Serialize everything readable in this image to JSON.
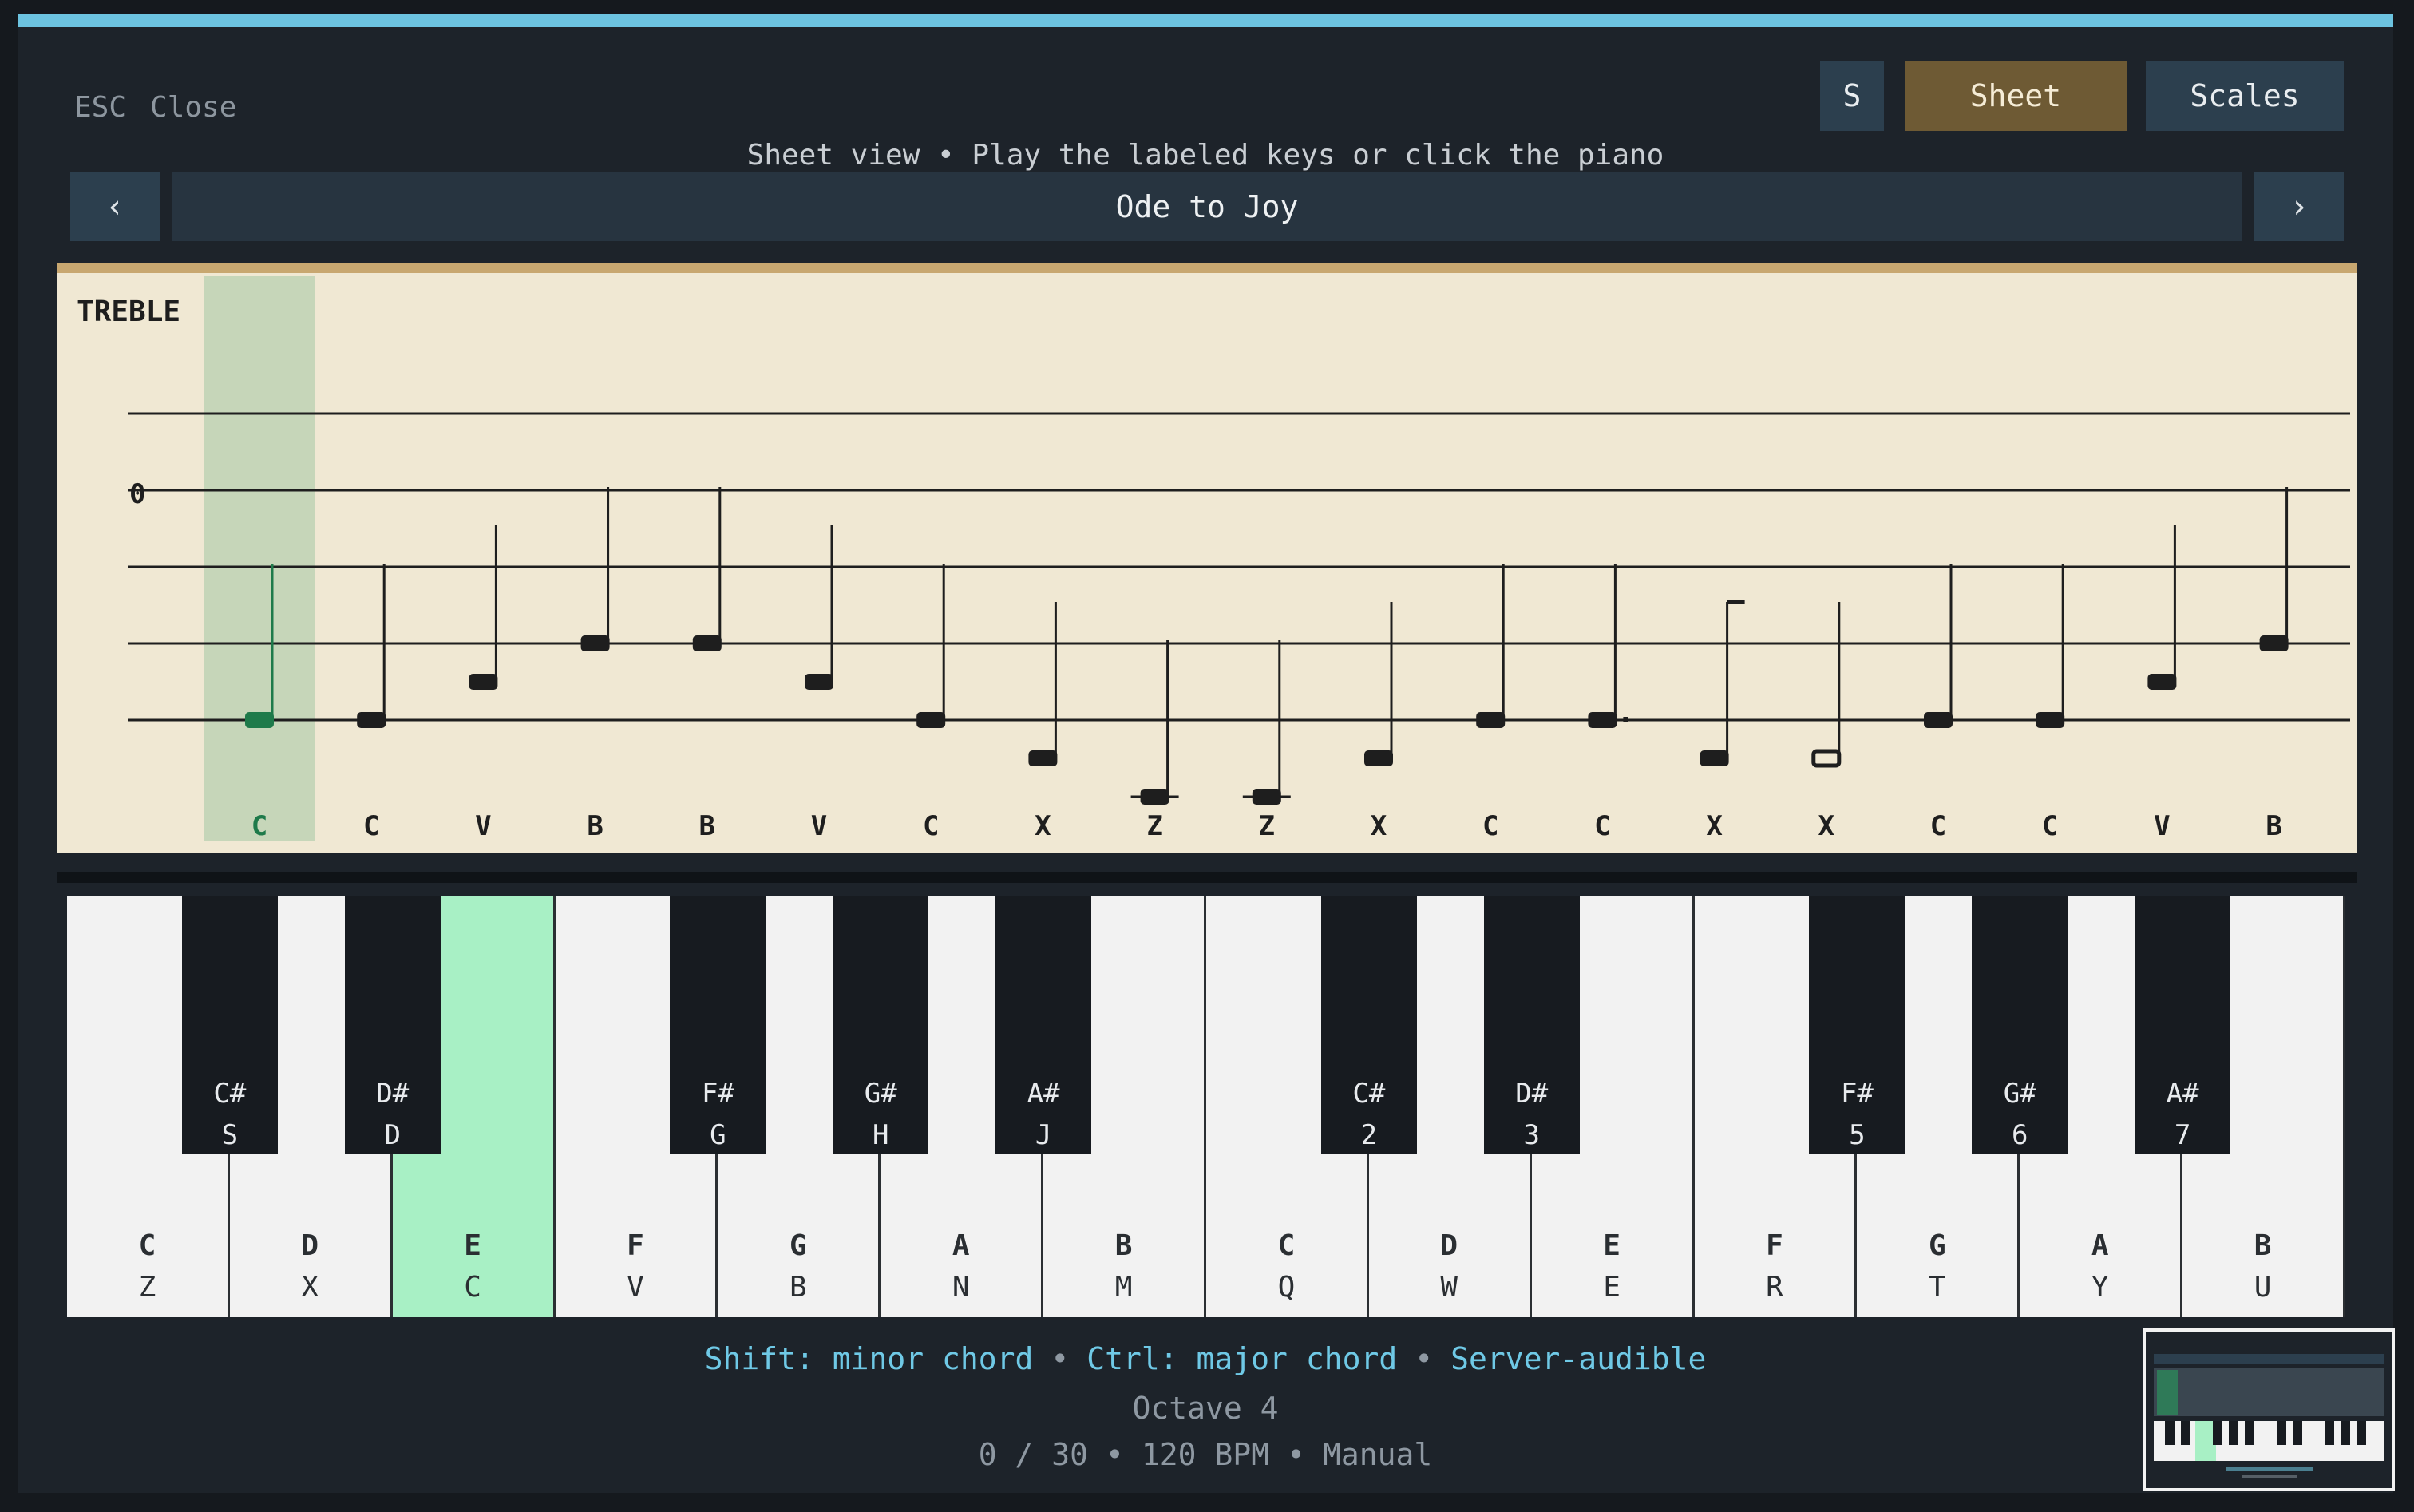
{
  "header": {
    "esc_key": "ESC",
    "esc_label": "Close",
    "subtitle": "Sheet view  •  Play the labeled keys or click the piano",
    "buttons": {
      "s": "S",
      "sheet": "Sheet",
      "scales": "Scales"
    }
  },
  "song_nav": {
    "prev_icon": "‹",
    "next_icon": "›",
    "title": "Ode to Joy"
  },
  "sheet": {
    "clef_label": "TREBLE",
    "time_marker": "0",
    "current_index": 0,
    "notes": [
      {
        "key": "C",
        "staff_step": 0,
        "duration": "quarter"
      },
      {
        "key": "C",
        "staff_step": 0,
        "duration": "quarter"
      },
      {
        "key": "V",
        "staff_step": 1,
        "duration": "quarter"
      },
      {
        "key": "B",
        "staff_step": 2,
        "duration": "quarter"
      },
      {
        "key": "B",
        "staff_step": 2,
        "duration": "quarter"
      },
      {
        "key": "V",
        "staff_step": 1,
        "duration": "quarter"
      },
      {
        "key": "C",
        "staff_step": 0,
        "duration": "quarter"
      },
      {
        "key": "X",
        "staff_step": -1,
        "duration": "quarter"
      },
      {
        "key": "Z",
        "staff_step": -2,
        "duration": "quarter"
      },
      {
        "key": "Z",
        "staff_step": -2,
        "duration": "quarter"
      },
      {
        "key": "X",
        "staff_step": -1,
        "duration": "quarter"
      },
      {
        "key": "C",
        "staff_step": 0,
        "duration": "quarter"
      },
      {
        "key": "C",
        "staff_step": 0,
        "duration": "dotted-quarter"
      },
      {
        "key": "X",
        "staff_step": -1,
        "duration": "eighth"
      },
      {
        "key": "X",
        "staff_step": -1,
        "duration": "half"
      },
      {
        "key": "C",
        "staff_step": 0,
        "duration": "quarter"
      },
      {
        "key": "C",
        "staff_step": 0,
        "duration": "quarter"
      },
      {
        "key": "V",
        "staff_step": 1,
        "duration": "quarter"
      },
      {
        "key": "B",
        "staff_step": 2,
        "duration": "quarter"
      }
    ]
  },
  "piano": {
    "white_keys": [
      {
        "note": "C",
        "bind": "Z",
        "active": false
      },
      {
        "note": "D",
        "bind": "X",
        "active": false
      },
      {
        "note": "E",
        "bind": "C",
        "active": true
      },
      {
        "note": "F",
        "bind": "V",
        "active": false
      },
      {
        "note": "G",
        "bind": "B",
        "active": false
      },
      {
        "note": "A",
        "bind": "N",
        "active": false
      },
      {
        "note": "B",
        "bind": "M",
        "active": false
      },
      {
        "note": "C",
        "bind": "Q",
        "active": false
      },
      {
        "note": "D",
        "bind": "W",
        "active": false
      },
      {
        "note": "E",
        "bind": "E",
        "active": false
      },
      {
        "note": "F",
        "bind": "R",
        "active": false
      },
      {
        "note": "G",
        "bind": "T",
        "active": false
      },
      {
        "note": "A",
        "bind": "Y",
        "active": false
      },
      {
        "note": "B",
        "bind": "U",
        "active": false
      }
    ],
    "black_keys": [
      {
        "note": "C#",
        "bind": "S",
        "after_white": 0
      },
      {
        "note": "D#",
        "bind": "D",
        "after_white": 1
      },
      {
        "note": "F#",
        "bind": "G",
        "after_white": 3
      },
      {
        "note": "G#",
        "bind": "H",
        "after_white": 4
      },
      {
        "note": "A#",
        "bind": "J",
        "after_white": 5
      },
      {
        "note": "C#",
        "bind": "2",
        "after_white": 7
      },
      {
        "note": "D#",
        "bind": "3",
        "after_white": 8
      },
      {
        "note": "F#",
        "bind": "5",
        "after_white": 10
      },
      {
        "note": "G#",
        "bind": "6",
        "after_white": 11
      },
      {
        "note": "A#",
        "bind": "7",
        "after_white": 12
      }
    ]
  },
  "footer": {
    "hint_minor": "Shift: minor chord",
    "hint_major": "Ctrl: major chord",
    "hint_server": "Server-audible",
    "separator": "•",
    "octave": "Octave 4",
    "progress": "0 / 30",
    "bpm": "120 BPM",
    "mode": "Manual"
  },
  "colors": {
    "accent_bar": "#6cc3e0",
    "active_key": "#a8f0c5",
    "current_note": "#1e7a4a",
    "sheet_bg": "#f0e8d3"
  }
}
